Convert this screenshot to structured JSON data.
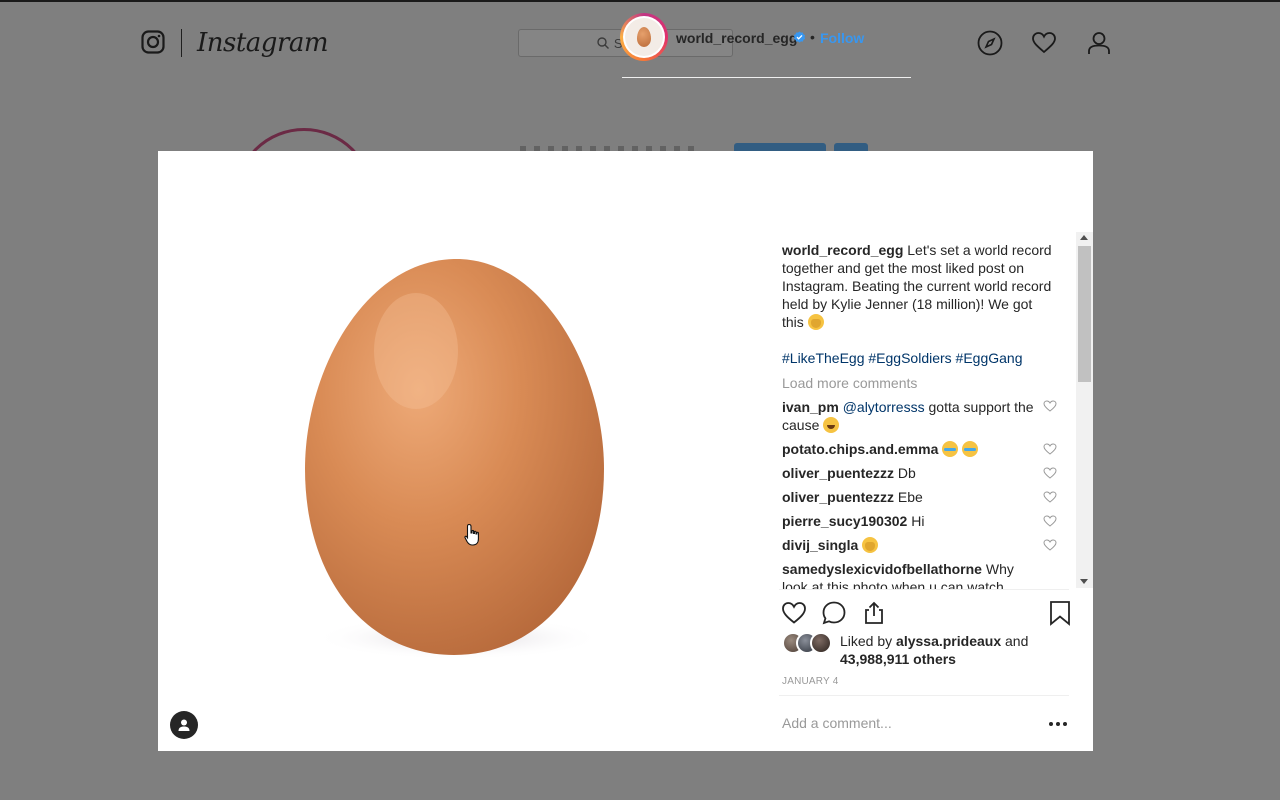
{
  "app": {
    "brand": "Instagram"
  },
  "search": {
    "placeholder": "Search"
  },
  "post": {
    "username": "world_record_egg",
    "follow_label": "Follow",
    "separator": "•",
    "caption_user": "world_record_egg",
    "caption_text": " Let's set a world record together and get the most liked post on Instagram. Beating the current world record held by Kylie Jenner (18 million)! We got this ",
    "hashtags": "#LikeTheEgg #EggSoldiers #EggGang",
    "load_more": "Load more comments",
    "comments": [
      {
        "user": "ivan_pm",
        "mention": "@alytorresss",
        "text": " gotta support the cause ",
        "emoji": "laugh"
      },
      {
        "user": "potato.chips.and.emma",
        "text": " ",
        "emoji": "cry-cry"
      },
      {
        "user": "oliver_puentezzz",
        "text": " Db"
      },
      {
        "user": "oliver_puentezzz",
        "text": " Ebe"
      },
      {
        "user": "pierre_sucy190302",
        "text": " Hi"
      },
      {
        "user": "divij_singla",
        "text": " ",
        "emoji": "raising-hands"
      },
      {
        "user": "samedyslexicvidofbellathorne",
        "text": " Why look at this photo when u can watch"
      }
    ],
    "liked_prefix": "Liked by ",
    "liked_by": "alyssa.prideaux",
    "liked_and": " and",
    "liked_others": "43,988,911 others",
    "date": "JANUARY 4",
    "add_comment_placeholder": "Add a comment..."
  },
  "colors": {
    "link": "#3897f0",
    "hashtag": "#003569",
    "muted": "#999999",
    "overlay": "#7f7f7f"
  },
  "icons": [
    "instagram-glyph-icon",
    "search-icon",
    "explore-compass-icon",
    "activity-heart-icon",
    "profile-icon",
    "verified-badge-icon",
    "like-heart-icon",
    "comment-icon",
    "share-icon",
    "bookmark-icon",
    "more-dots-icon",
    "tag-user-icon",
    "hand-cursor-icon"
  ]
}
